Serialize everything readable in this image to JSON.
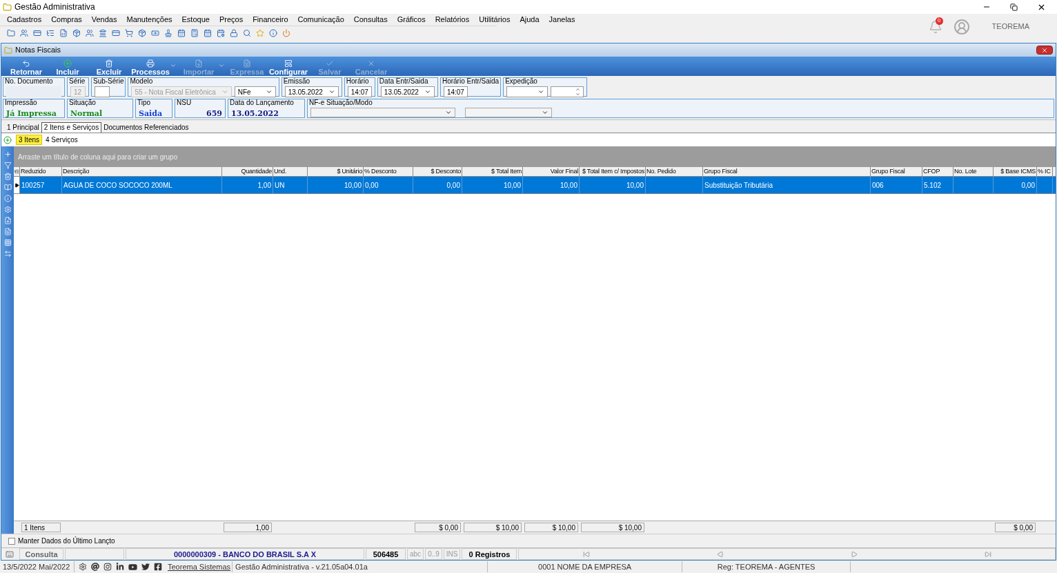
{
  "window": {
    "title": "Gestão Administrativa"
  },
  "menu": [
    "Cadastros",
    "Compras",
    "Vendas",
    "Manutenções",
    "Estoque",
    "Preços",
    "Financeiro",
    "Comunicação",
    "Consultas",
    "Gráficos",
    "Relatórios",
    "Utilitários",
    "Ajuda",
    "Janelas"
  ],
  "notifications": {
    "count": "0"
  },
  "user": {
    "name": "TEOREMA"
  },
  "form": {
    "title": "Notas Fiscais",
    "actions": [
      {
        "label": "Retornar",
        "disabled": false,
        "has_menu": false
      },
      {
        "label": "Incluir",
        "disabled": false,
        "has_menu": false
      },
      {
        "label": "Excluir",
        "disabled": false,
        "has_menu": false
      },
      {
        "label": "Processos",
        "disabled": false,
        "has_menu": true
      },
      {
        "label": "Importar",
        "disabled": true,
        "has_menu": true
      },
      {
        "label": "Expressa",
        "disabled": true,
        "has_menu": false
      },
      {
        "label": "Configurar",
        "disabled": false,
        "has_menu": false
      },
      {
        "label": "Salvar",
        "disabled": true,
        "has_menu": false
      },
      {
        "label": "Cancelar",
        "disabled": true,
        "has_menu": false
      }
    ],
    "header_fields": [
      {
        "label": "No. Documento",
        "controls": [
          {
            "kind": "plain"
          }
        ]
      },
      {
        "label": "Série",
        "controls": [
          {
            "kind": "text",
            "value": "12",
            "disabled": true
          }
        ]
      },
      {
        "label": "Sub-Série",
        "controls": [
          {
            "kind": "text",
            "disabled": false
          }
        ]
      },
      {
        "label": "Modelo",
        "controls": [
          {
            "kind": "combo",
            "value": "55 - Nota Fiscal Eletrônica",
            "disabled": true
          },
          {
            "kind": "combo",
            "value": "NFe",
            "disabled": false
          }
        ]
      },
      {
        "label": "Emissão",
        "controls": [
          {
            "kind": "combo",
            "value": "13.05.2022",
            "disabled": false
          }
        ]
      },
      {
        "label": "Horário",
        "controls": [
          {
            "kind": "text",
            "value": "14:07",
            "disabled": false
          }
        ]
      },
      {
        "label": "Data Entr/Saida",
        "controls": [
          {
            "kind": "combo",
            "value": "13.05.2022",
            "disabled": false
          }
        ]
      },
      {
        "label": "Horário Entr/Saida",
        "controls": [
          {
            "kind": "text",
            "value": "14:07",
            "disabled": false
          }
        ]
      },
      {
        "label": "Expedição",
        "controls": [
          {
            "kind": "combo",
            "disabled": false
          },
          {
            "kind": "spin",
            "disabled": false
          }
        ]
      }
    ],
    "status_fields": [
      {
        "label": "Impressão",
        "value": "Já Impressa",
        "color": "#1a8a1a"
      },
      {
        "label": "Situação",
        "value": "Normal",
        "color": "#1a8a1a"
      },
      {
        "label": "Tipo",
        "value": "Saida",
        "color": "#1a3fd0"
      },
      {
        "label": "NSU",
        "value": "659",
        "color": "#1a1a80"
      },
      {
        "label": "Data do Lançamento",
        "value": "13.05.2022",
        "color": "#1a1a80"
      }
    ],
    "nfe_status": {
      "label": "NF-e Situação/Modo"
    },
    "tabs": [
      {
        "label": "1 Principal",
        "selected": false
      },
      {
        "label": "2 Itens e Serviços",
        "selected": true
      },
      {
        "label": "Documentos Referenciados",
        "selected": false
      }
    ],
    "subtabs": [
      {
        "label": "3 Itens",
        "selected": true
      },
      {
        "label": "4 Serviços",
        "selected": false
      }
    ],
    "grid": {
      "group_hint": "Arraste um título de coluna aqui para criar um grupo",
      "columns": [
        {
          "label": "Reduzido",
          "total": "1 Itens"
        },
        {
          "label": "Descrição"
        },
        {
          "label": "Quantidade",
          "total": "1,00"
        },
        {
          "label": "Und."
        },
        {
          "label": "$ Unitário"
        },
        {
          "label": "% Desconto"
        },
        {
          "label": "$ Desconto",
          "total": "$ 0,00"
        },
        {
          "label": "$ Total Item",
          "total": "$ 10,00"
        },
        {
          "label": "Valor Final",
          "total": "$ 10,00"
        },
        {
          "label": "$ Total Item c/ Impostos",
          "total": "$ 10,00"
        },
        {
          "label": "No. Pedido"
        },
        {
          "label": "Grupo Fiscal"
        },
        {
          "label": "Grupo Fiscal"
        },
        {
          "label": "CFOP"
        },
        {
          "label": "No. Lote"
        },
        {
          "label": "$ Base ICMS",
          "total": "$ 0,00"
        },
        {
          "label": "% IC"
        }
      ],
      "rows": [
        {
          "selected": true,
          "cells": [
            "100257",
            "AGUA DE COCO SOCOCO 200ML",
            "1,00",
            "UN",
            "10,00",
            "0,00",
            "0,00",
            "10,00",
            "10,00",
            "10,00",
            null,
            "Substituição Tributária",
            "006",
            "5.102",
            null,
            "0,00",
            null
          ]
        }
      ]
    },
    "keep_data": {
      "label": "Manter Dados do Último Lançto",
      "checked": false
    },
    "status_bar": {
      "mode": "Consulta",
      "account": "0000000309 - BANCO DO BRASIL S.A X",
      "code": "506485",
      "indicators": [
        "abc",
        "0..9",
        "INS"
      ],
      "records": "0 Registros"
    }
  },
  "footer": {
    "date": "13/5/2022 Mai/2022",
    "link": "Teorema Sistemas",
    "version": "Gestão Administrativa - v.21.05a04.01a",
    "company": "0001 NOME DA EMPRESA",
    "registration": "Reg: TEOREMA - AGENTES"
  }
}
